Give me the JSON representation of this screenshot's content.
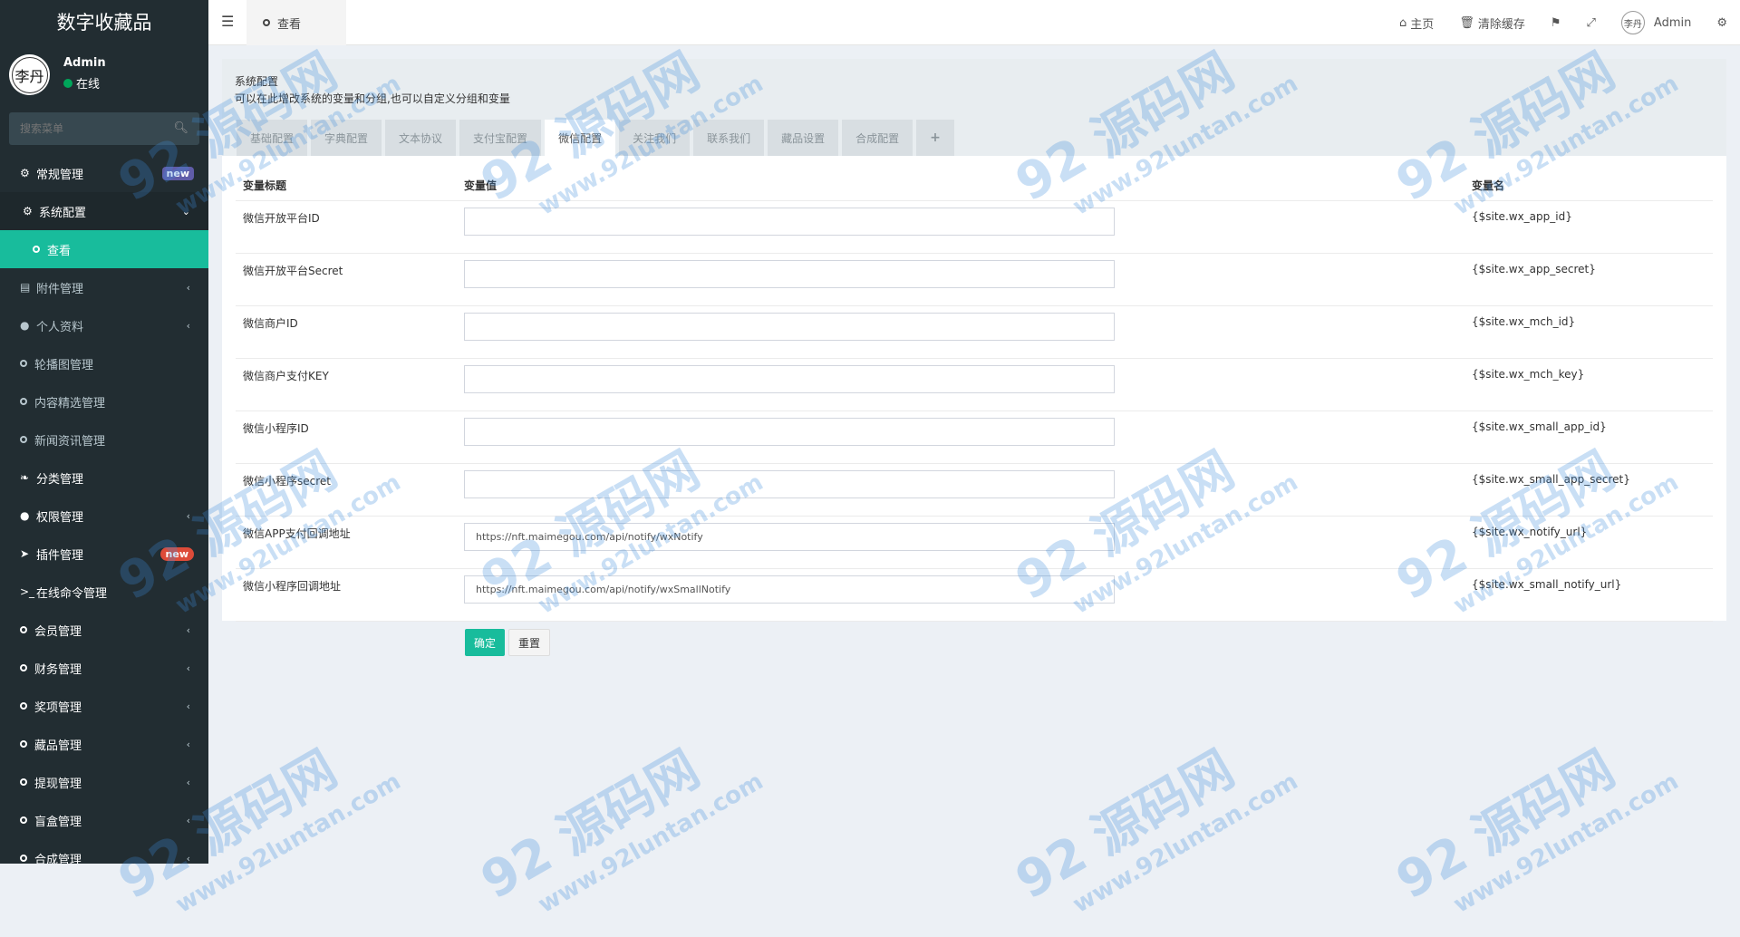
{
  "app": {
    "title": "数字收藏品"
  },
  "user": {
    "name": "Admin",
    "status": "在线",
    "avatar_text": "李丹"
  },
  "search": {
    "placeholder": "搜索菜单"
  },
  "sidebar": {
    "items": [
      {
        "label": "常规管理",
        "icon": "cogs-icon",
        "badge": "new"
      },
      {
        "label": "系统配置",
        "icon": "gear-icon"
      },
      {
        "label": "查看",
        "icon": "circle-icon"
      },
      {
        "label": "附件管理",
        "icon": "file-image-icon"
      },
      {
        "label": "个人资料",
        "icon": "user-icon"
      },
      {
        "label": "轮播图管理",
        "icon": "circle-icon"
      },
      {
        "label": "内容精选管理",
        "icon": "circle-icon"
      },
      {
        "label": "新闻资讯管理",
        "icon": "circle-icon"
      },
      {
        "label": "分类管理",
        "icon": "leaf-icon"
      },
      {
        "label": "权限管理",
        "icon": "group-icon"
      },
      {
        "label": "插件管理",
        "icon": "rocket-icon",
        "badge": "new"
      },
      {
        "label": "在线命令管理",
        "icon": "terminal-icon"
      },
      {
        "label": "会员管理",
        "icon": "circle-icon"
      },
      {
        "label": "财务管理",
        "icon": "circle-icon"
      },
      {
        "label": "奖项管理",
        "icon": "circle-icon"
      },
      {
        "label": "藏品管理",
        "icon": "circle-icon"
      },
      {
        "label": "提现管理",
        "icon": "circle-icon"
      },
      {
        "label": "盲盒管理",
        "icon": "circle-icon"
      },
      {
        "label": "合成管理",
        "icon": "circle-icon"
      }
    ]
  },
  "navbar": {
    "tab_label": "查看",
    "home_label": "主页",
    "clear_cache_label": "清除缓存",
    "admin_label": "Admin"
  },
  "panel": {
    "title": "系统配置",
    "description": "可以在此增改系统的变量和分组,也可以自定义分组和变量",
    "tabs": [
      "基础配置",
      "字典配置",
      "文本协议",
      "支付宝配置",
      "微信配置",
      "关注我们",
      "联系我们",
      "藏品设置",
      "合成配置",
      "+"
    ]
  },
  "table": {
    "headers": [
      "变量标题",
      "变量值",
      "变量名"
    ],
    "rows": [
      {
        "label": "微信开放平台ID",
        "value": "",
        "key": "{$site.wx_app_id}"
      },
      {
        "label": "微信开放平台Secret",
        "value": "",
        "key": "{$site.wx_app_secret}"
      },
      {
        "label": "微信商户ID",
        "value": "",
        "key": "{$site.wx_mch_id}"
      },
      {
        "label": "微信商户支付KEY",
        "value": "",
        "key": "{$site.wx_mch_key}"
      },
      {
        "label": "微信小程序ID",
        "value": "",
        "key": "{$site.wx_small_app_id}"
      },
      {
        "label": "微信小程序secret",
        "value": "",
        "key": "{$site.wx_small_app_secret}"
      },
      {
        "label": "微信APP支付回调地址",
        "value": "https://nft.maimegou.com/api/notify/wxNotify",
        "key": "{$site.wx_notify_url}"
      },
      {
        "label": "微信小程序回调地址",
        "value": "https://nft.maimegou.com/api/notify/wxSmallNotify",
        "key": "{$site.wx_small_notify_url}"
      }
    ]
  },
  "buttons": {
    "confirm": "确定",
    "reset": "重置"
  },
  "watermark": {
    "main": "92 源码网",
    "url": "www.92luntan.com"
  },
  "colors": {
    "sidebar_bg": "#222d32",
    "accent": "#18bc9c",
    "badge_new_purple": "#605ca8",
    "badge_new_red": "#dd4b39"
  }
}
